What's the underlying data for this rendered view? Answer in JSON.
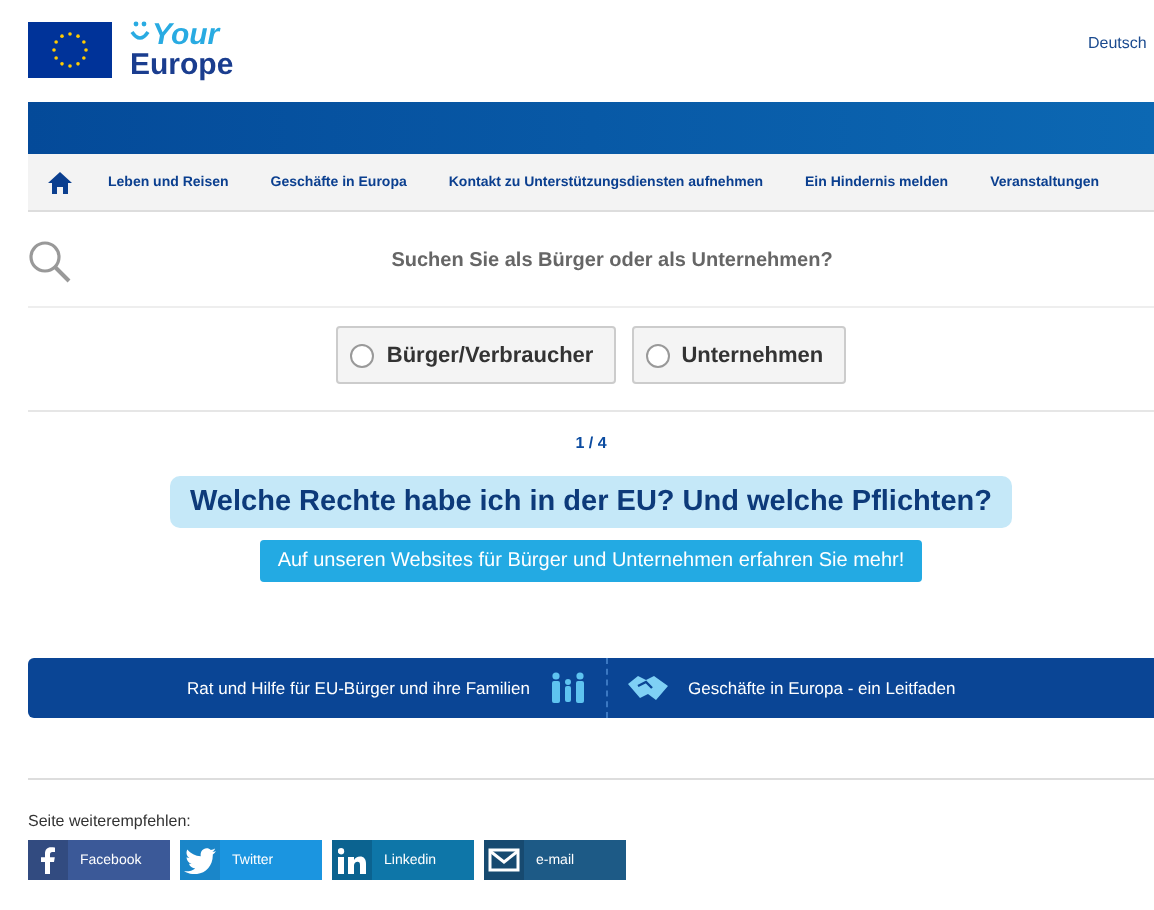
{
  "header": {
    "logo_top": "Your",
    "logo_bottom": "Europe",
    "language": "Deutsch"
  },
  "nav": {
    "items": [
      {
        "label": "Leben und Reisen"
      },
      {
        "label": "Geschäfte in Europa"
      },
      {
        "label": "Kontakt zu Unterstützungsdiensten aufnehmen"
      },
      {
        "label": "Ein Hindernis melden"
      },
      {
        "label": "Veranstaltungen"
      }
    ]
  },
  "search": {
    "question": "Suchen Sie als Bürger oder als Unternehmen?",
    "options": [
      {
        "label": "Bürger/Verbraucher",
        "selected": false
      },
      {
        "label": "Unternehmen",
        "selected": false
      }
    ]
  },
  "carousel": {
    "pager": "1 / 4",
    "headline": "Welche Rechte habe ich in der EU? Und welche Pflichten?",
    "cta": "Auf unseren Websites für Bürger und Unternehmen erfahren Sie mehr!"
  },
  "band": [
    {
      "label": "Rat und Hilfe für EU-Bürger und ihre Familien",
      "kind": "people"
    },
    {
      "label": "Geschäfte in Europa - ein Leitfaden",
      "kind": "handshake"
    }
  ],
  "share": {
    "label": "Seite weiterempfehlen:",
    "buttons": [
      {
        "label": "Facebook",
        "kind": "facebook"
      },
      {
        "label": "Twitter",
        "kind": "twitter"
      },
      {
        "label": "Linkedin",
        "kind": "linkedin"
      },
      {
        "label": "e-mail",
        "kind": "email"
      }
    ]
  }
}
